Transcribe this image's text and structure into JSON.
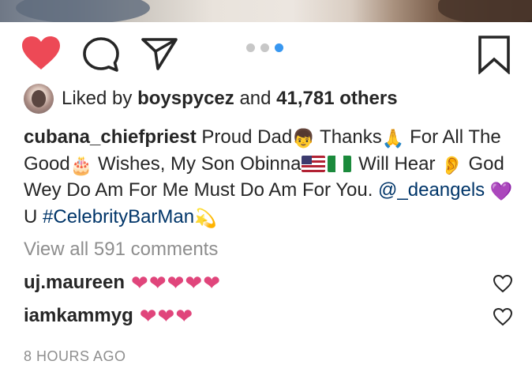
{
  "post": {
    "liked_by_prefix": "Liked by",
    "liked_by_user": "boyspycez",
    "liked_by_and": "and",
    "liked_by_others": "41,781 others",
    "caption": {
      "username": "cubana_chiefpriest",
      "text_1": "Proud Dad",
      "emoji_boy": "👦",
      "text_2": "Thanks",
      "emoji_pray": "🙏",
      "text_3": "For All The Good",
      "emoji_cake": "🎂",
      "text_4": "Wishes, My Son Obinna",
      "text_5": "Will Hear",
      "emoji_ear": "👂",
      "text_6": "God Wey Do Am For Me Must Do Am For You.",
      "mention": "@_deangels",
      "emoji_heart": "💜",
      "text_7": "U",
      "hashtag": "#CelebrityBarMan",
      "emoji_dizzy": "💫"
    },
    "view_all_comments": "View all 591 comments",
    "comments": [
      {
        "username": "uj.maureen",
        "text": "❤❤❤❤❤"
      },
      {
        "username": "iamkammyg",
        "text": "❤❤❤"
      }
    ],
    "timestamp": "8 HOURS AGO"
  },
  "carousel": {
    "count": 3,
    "active_index": 2
  },
  "icons": {
    "like": "heart-icon",
    "comment": "comment-icon",
    "share": "paper-plane-icon",
    "save": "bookmark-icon"
  },
  "colors": {
    "like_red": "#ed4956",
    "text": "#262626",
    "muted": "#8e8e8e",
    "link": "#003569",
    "carousel_active": "#3897f0",
    "heart_pink": "#e0457b"
  }
}
